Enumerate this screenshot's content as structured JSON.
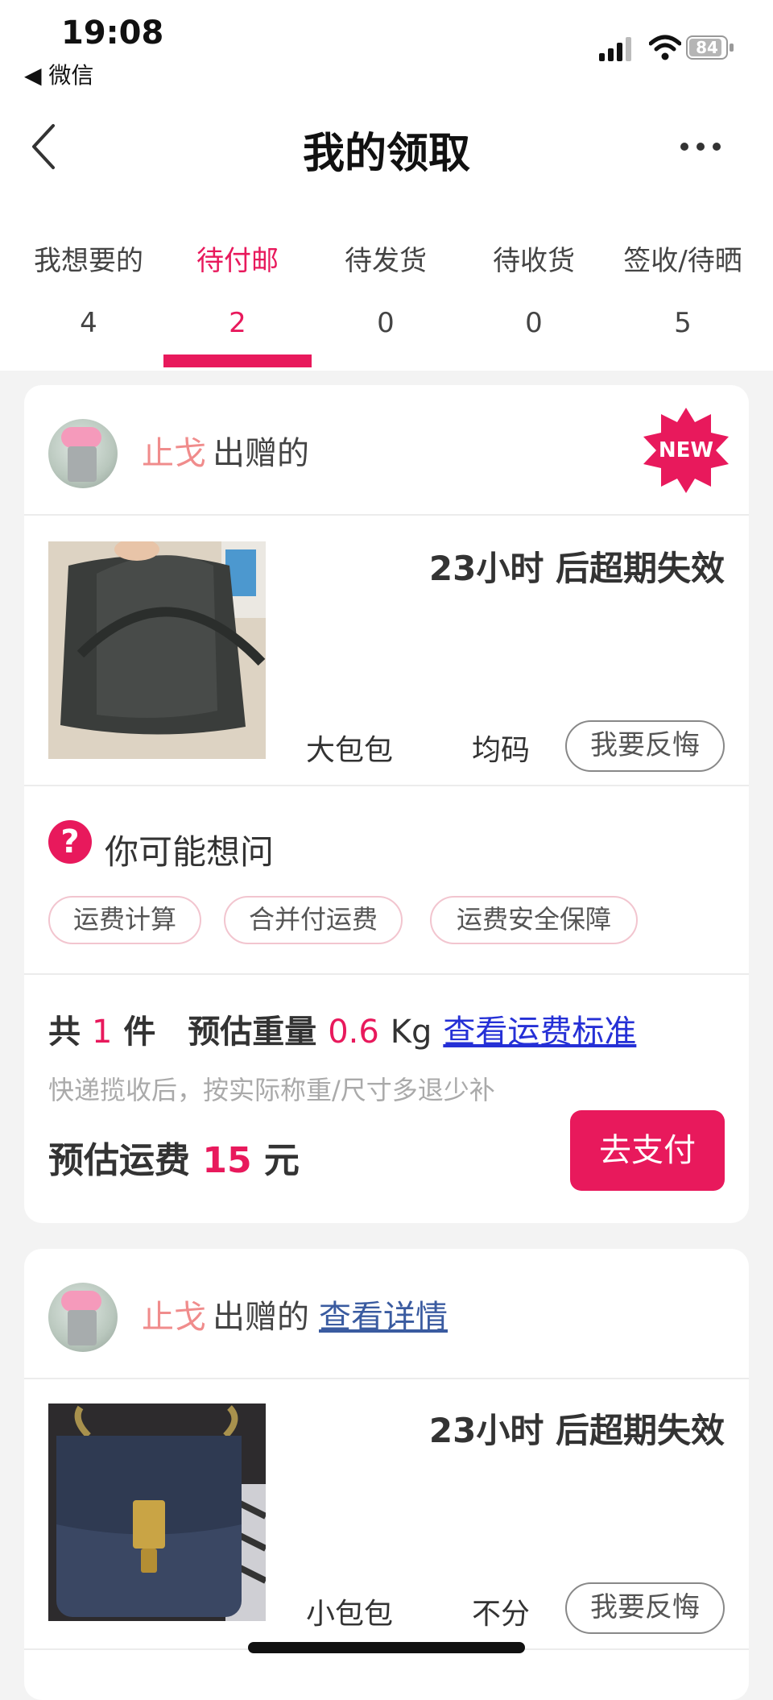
{
  "status_bar": {
    "time": "19:08",
    "back_app": "◀ 微信",
    "battery": "84"
  },
  "nav": {
    "title": "我的领取"
  },
  "tabs": [
    {
      "label": "我想要的",
      "count": "4"
    },
    {
      "label": "待付邮",
      "count": "2"
    },
    {
      "label": "待发货",
      "count": "0"
    },
    {
      "label": "待收货",
      "count": "0"
    },
    {
      "label": "签收/待晒",
      "count": "5"
    }
  ],
  "cards": [
    {
      "seller": "止戈",
      "gift_suffix": "出赠的",
      "badge": "NEW",
      "countdown": "23小时 后超期失效",
      "item_name": "大包包",
      "item_size": "均码",
      "regret_label": "我要反悔",
      "faq_title": "你可能想问",
      "faq_chips": [
        "运费计算",
        "合并付运费",
        "运费安全保障"
      ],
      "summary": {
        "count_prefix": "共",
        "count": "1",
        "count_suffix": "件",
        "weight_label": "预估重量",
        "weight": "0.6",
        "weight_unit": "Kg",
        "standard_link": "查看运费标准"
      },
      "note": "快递揽收后，按实际称重/尺寸多退少补",
      "fee_label": "预估运费",
      "fee": "15",
      "fee_unit": "元",
      "pay_label": "去支付"
    },
    {
      "seller": "止戈",
      "gift_suffix": "出赠的",
      "detail_link": "查看详情",
      "countdown": "23小时 后超期失效",
      "item_name": "小包包",
      "item_size": "不分",
      "regret_label": "我要反悔"
    }
  ],
  "colors": {
    "accent": "#e8195c",
    "seller": "#f08c8c",
    "link": "#2530d6"
  },
  "icons": [
    "signal-icon",
    "wifi-icon",
    "battery-icon",
    "back-arrow-icon",
    "more-icon",
    "question-icon",
    "new-badge-icon"
  ]
}
